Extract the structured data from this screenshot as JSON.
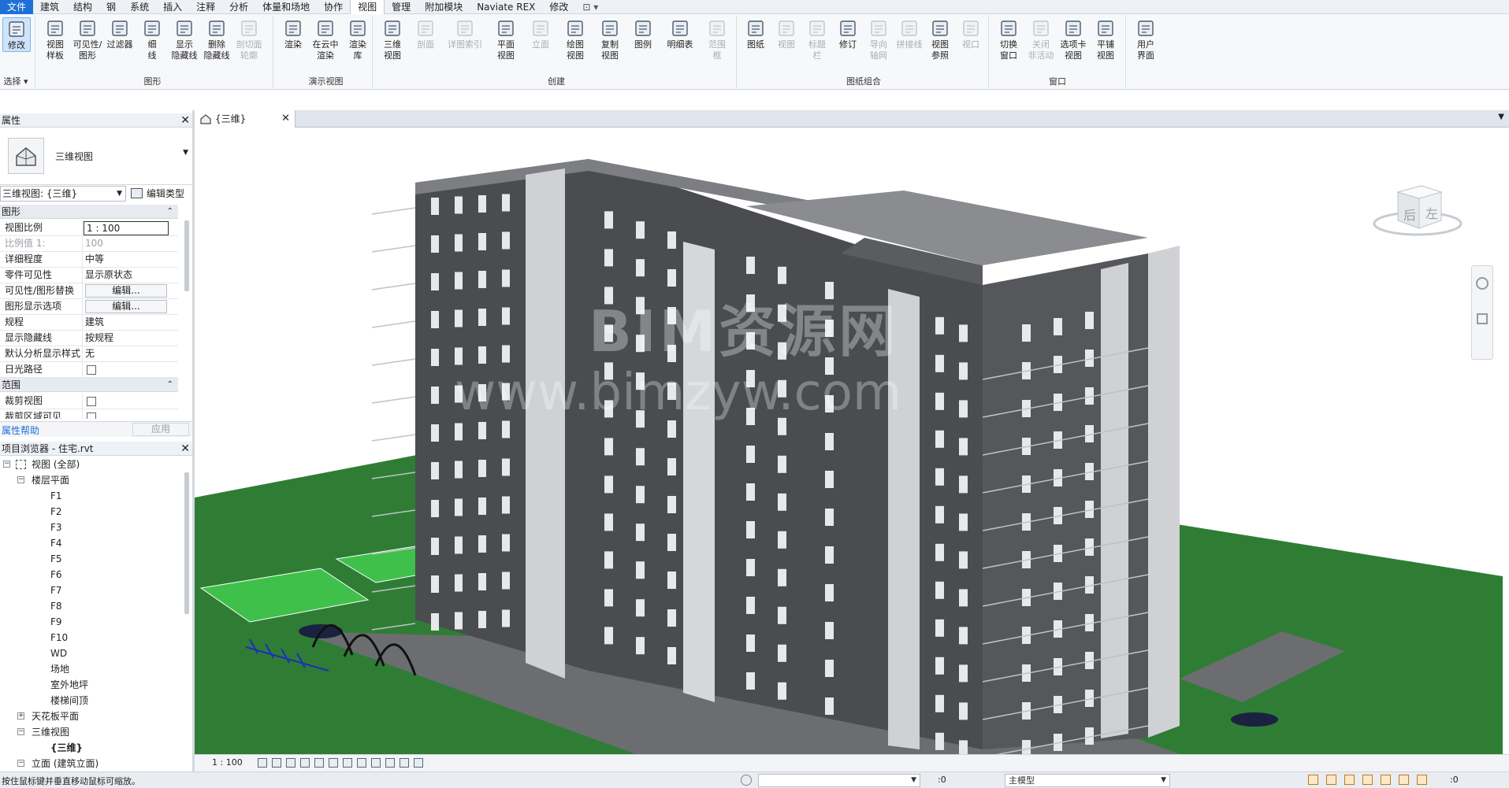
{
  "menu": {
    "tabs": [
      "文件",
      "建筑",
      "结构",
      "钢",
      "系统",
      "插入",
      "注释",
      "分析",
      "体量和场地",
      "协作",
      "视图",
      "管理",
      "附加模块",
      "Naviate REX",
      "修改"
    ],
    "active_tab": "视图"
  },
  "ribbon": {
    "modify": "修改",
    "select_panel": "选择",
    "graphics_buttons": [
      {
        "label": "视图\n样板",
        "enabled": true
      },
      {
        "label": "可见性/\n图形",
        "enabled": true
      },
      {
        "label": "过滤器",
        "enabled": true
      },
      {
        "label": "细\n线",
        "enabled": true
      },
      {
        "label": "显示\n隐藏线",
        "enabled": true
      },
      {
        "label": "删除\n隐藏线",
        "enabled": true
      },
      {
        "label": "剖切面\n轮廓",
        "enabled": false
      }
    ],
    "graphics_panel": "图形",
    "presentation_buttons": [
      {
        "label": "渲染",
        "enabled": true
      },
      {
        "label": "在云中\n渲染",
        "enabled": true
      },
      {
        "label": "渲染\n库",
        "enabled": true
      }
    ],
    "presentation_panel": "演示视图",
    "create_buttons": [
      {
        "label": "三维\n视图",
        "enabled": true
      },
      {
        "label": "剖面",
        "enabled": false
      },
      {
        "label": "详图索引",
        "enabled": false
      },
      {
        "label": "平面\n视图",
        "enabled": true
      },
      {
        "label": "立面",
        "enabled": false
      },
      {
        "label": "绘图\n视图",
        "enabled": true
      },
      {
        "label": "复制\n视图",
        "enabled": true
      },
      {
        "label": "图例",
        "enabled": true
      },
      {
        "label": "明细表",
        "enabled": true
      },
      {
        "label": "范围\n框",
        "enabled": false
      }
    ],
    "create_panel": "创建",
    "sheet_buttons": [
      {
        "label": "图纸",
        "enabled": true
      },
      {
        "label": "视图",
        "enabled": false
      },
      {
        "label": "标题\n栏",
        "enabled": false
      },
      {
        "label": "修订",
        "enabled": true
      },
      {
        "label": "导向\n轴网",
        "enabled": false
      },
      {
        "label": "拼接线",
        "enabled": false
      },
      {
        "label": "视图\n参照",
        "enabled": true
      },
      {
        "label": "视口",
        "enabled": false
      }
    ],
    "sheet_panel": "图纸组合",
    "window_buttons": [
      {
        "label": "切换\n窗口",
        "enabled": true
      },
      {
        "label": "关闭\n非活动",
        "enabled": false
      },
      {
        "label": "选项卡\n视图",
        "enabled": true
      },
      {
        "label": "平铺\n视图",
        "enabled": true
      }
    ],
    "window_panel": "窗口",
    "ui_button": {
      "label": "用户\n界面",
      "enabled": true
    }
  },
  "properties": {
    "title": "属性",
    "type_name": "三维视图",
    "instance_selector": "三维视图: {三维}",
    "edit_type": "编辑类型",
    "sections": [
      {
        "name": "图形",
        "top": 0
      },
      {
        "name": "范围",
        "top": 1
      }
    ],
    "rows_graphics": [
      {
        "k": "视图比例",
        "v": "1 : 100",
        "kind": "input"
      },
      {
        "k": "比例值 1:",
        "v": "100",
        "kind": "disabled"
      },
      {
        "k": "详细程度",
        "v": "中等",
        "kind": "text"
      },
      {
        "k": "零件可见性",
        "v": "显示原状态",
        "kind": "text"
      },
      {
        "k": "可见性/图形替换",
        "v": "编辑...",
        "kind": "button"
      },
      {
        "k": "图形显示选项",
        "v": "编辑...",
        "kind": "button"
      },
      {
        "k": "规程",
        "v": "建筑",
        "kind": "text"
      },
      {
        "k": "显示隐藏线",
        "v": "按规程",
        "kind": "text"
      },
      {
        "k": "默认分析显示样式",
        "v": "无",
        "kind": "text"
      },
      {
        "k": "日光路径",
        "v": "",
        "kind": "checkbox"
      }
    ],
    "rows_extent": [
      {
        "k": "裁剪视图",
        "v": "",
        "kind": "checkbox"
      },
      {
        "k": "裁剪区域可见",
        "v": "",
        "kind": "checkbox"
      }
    ],
    "help": "属性帮助",
    "apply": "应用"
  },
  "browser": {
    "title": "项目浏览器 - 住宅.rvt",
    "items": [
      {
        "label": "视图 (全部)",
        "level": 0,
        "exp": "−",
        "icon": true
      },
      {
        "label": "楼层平面",
        "level": 1,
        "exp": "−"
      },
      {
        "label": "F1",
        "level": 2
      },
      {
        "label": "F2",
        "level": 2
      },
      {
        "label": "F3",
        "level": 2
      },
      {
        "label": "F4",
        "level": 2
      },
      {
        "label": "F5",
        "level": 2
      },
      {
        "label": "F6",
        "level": 2
      },
      {
        "label": "F7",
        "level": 2
      },
      {
        "label": "F8",
        "level": 2
      },
      {
        "label": "F9",
        "level": 2
      },
      {
        "label": "F10",
        "level": 2
      },
      {
        "label": "WD",
        "level": 2
      },
      {
        "label": "场地",
        "level": 2
      },
      {
        "label": "室外地坪",
        "level": 2
      },
      {
        "label": "楼梯间顶",
        "level": 2
      },
      {
        "label": "天花板平面",
        "level": 1,
        "exp": "+"
      },
      {
        "label": "三维视图",
        "level": 1,
        "exp": "−"
      },
      {
        "label": "{三维}",
        "level": 2,
        "bold": true
      },
      {
        "label": "立面 (建筑立面)",
        "level": 1,
        "exp": "−"
      }
    ]
  },
  "view": {
    "tab_label": "{三维}",
    "viewcube_left": "左",
    "viewcube_back": "后",
    "watermark_1": "BIM资源网",
    "watermark_2": "www.bimzyw.com",
    "scale": "1 : 100"
  },
  "status": {
    "hint": "按住鼠标键并垂直移动鼠标可缩放。",
    "selection_count": ":0",
    "model": "主模型",
    "filter_count": ":0"
  },
  "colors": {
    "accent": "#1f6fd6",
    "grass": "#2f7d35",
    "building_dark": "#4a4c50",
    "building_light": "#cfd1d4"
  }
}
